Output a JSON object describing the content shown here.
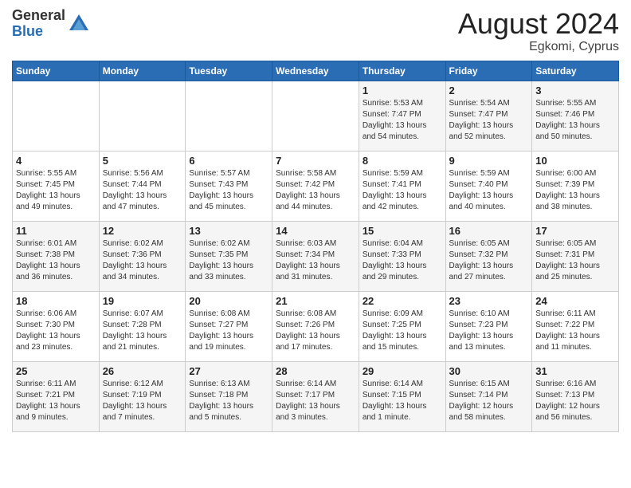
{
  "logo": {
    "general": "General",
    "blue": "Blue"
  },
  "title": {
    "month_year": "August 2024",
    "location": "Egkomi, Cyprus"
  },
  "calendar": {
    "headers": [
      "Sunday",
      "Monday",
      "Tuesday",
      "Wednesday",
      "Thursday",
      "Friday",
      "Saturday"
    ],
    "weeks": [
      [
        {
          "day": "",
          "details": ""
        },
        {
          "day": "",
          "details": ""
        },
        {
          "day": "",
          "details": ""
        },
        {
          "day": "",
          "details": ""
        },
        {
          "day": "1",
          "details": "Sunrise: 5:53 AM\nSunset: 7:47 PM\nDaylight: 13 hours\nand 54 minutes."
        },
        {
          "day": "2",
          "details": "Sunrise: 5:54 AM\nSunset: 7:47 PM\nDaylight: 13 hours\nand 52 minutes."
        },
        {
          "day": "3",
          "details": "Sunrise: 5:55 AM\nSunset: 7:46 PM\nDaylight: 13 hours\nand 50 minutes."
        }
      ],
      [
        {
          "day": "4",
          "details": "Sunrise: 5:55 AM\nSunset: 7:45 PM\nDaylight: 13 hours\nand 49 minutes."
        },
        {
          "day": "5",
          "details": "Sunrise: 5:56 AM\nSunset: 7:44 PM\nDaylight: 13 hours\nand 47 minutes."
        },
        {
          "day": "6",
          "details": "Sunrise: 5:57 AM\nSunset: 7:43 PM\nDaylight: 13 hours\nand 45 minutes."
        },
        {
          "day": "7",
          "details": "Sunrise: 5:58 AM\nSunset: 7:42 PM\nDaylight: 13 hours\nand 44 minutes."
        },
        {
          "day": "8",
          "details": "Sunrise: 5:59 AM\nSunset: 7:41 PM\nDaylight: 13 hours\nand 42 minutes."
        },
        {
          "day": "9",
          "details": "Sunrise: 5:59 AM\nSunset: 7:40 PM\nDaylight: 13 hours\nand 40 minutes."
        },
        {
          "day": "10",
          "details": "Sunrise: 6:00 AM\nSunset: 7:39 PM\nDaylight: 13 hours\nand 38 minutes."
        }
      ],
      [
        {
          "day": "11",
          "details": "Sunrise: 6:01 AM\nSunset: 7:38 PM\nDaylight: 13 hours\nand 36 minutes."
        },
        {
          "day": "12",
          "details": "Sunrise: 6:02 AM\nSunset: 7:36 PM\nDaylight: 13 hours\nand 34 minutes."
        },
        {
          "day": "13",
          "details": "Sunrise: 6:02 AM\nSunset: 7:35 PM\nDaylight: 13 hours\nand 33 minutes."
        },
        {
          "day": "14",
          "details": "Sunrise: 6:03 AM\nSunset: 7:34 PM\nDaylight: 13 hours\nand 31 minutes."
        },
        {
          "day": "15",
          "details": "Sunrise: 6:04 AM\nSunset: 7:33 PM\nDaylight: 13 hours\nand 29 minutes."
        },
        {
          "day": "16",
          "details": "Sunrise: 6:05 AM\nSunset: 7:32 PM\nDaylight: 13 hours\nand 27 minutes."
        },
        {
          "day": "17",
          "details": "Sunrise: 6:05 AM\nSunset: 7:31 PM\nDaylight: 13 hours\nand 25 minutes."
        }
      ],
      [
        {
          "day": "18",
          "details": "Sunrise: 6:06 AM\nSunset: 7:30 PM\nDaylight: 13 hours\nand 23 minutes."
        },
        {
          "day": "19",
          "details": "Sunrise: 6:07 AM\nSunset: 7:28 PM\nDaylight: 13 hours\nand 21 minutes."
        },
        {
          "day": "20",
          "details": "Sunrise: 6:08 AM\nSunset: 7:27 PM\nDaylight: 13 hours\nand 19 minutes."
        },
        {
          "day": "21",
          "details": "Sunrise: 6:08 AM\nSunset: 7:26 PM\nDaylight: 13 hours\nand 17 minutes."
        },
        {
          "day": "22",
          "details": "Sunrise: 6:09 AM\nSunset: 7:25 PM\nDaylight: 13 hours\nand 15 minutes."
        },
        {
          "day": "23",
          "details": "Sunrise: 6:10 AM\nSunset: 7:23 PM\nDaylight: 13 hours\nand 13 minutes."
        },
        {
          "day": "24",
          "details": "Sunrise: 6:11 AM\nSunset: 7:22 PM\nDaylight: 13 hours\nand 11 minutes."
        }
      ],
      [
        {
          "day": "25",
          "details": "Sunrise: 6:11 AM\nSunset: 7:21 PM\nDaylight: 13 hours\nand 9 minutes."
        },
        {
          "day": "26",
          "details": "Sunrise: 6:12 AM\nSunset: 7:19 PM\nDaylight: 13 hours\nand 7 minutes."
        },
        {
          "day": "27",
          "details": "Sunrise: 6:13 AM\nSunset: 7:18 PM\nDaylight: 13 hours\nand 5 minutes."
        },
        {
          "day": "28",
          "details": "Sunrise: 6:14 AM\nSunset: 7:17 PM\nDaylight: 13 hours\nand 3 minutes."
        },
        {
          "day": "29",
          "details": "Sunrise: 6:14 AM\nSunset: 7:15 PM\nDaylight: 13 hours\nand 1 minute."
        },
        {
          "day": "30",
          "details": "Sunrise: 6:15 AM\nSunset: 7:14 PM\nDaylight: 12 hours\nand 58 minutes."
        },
        {
          "day": "31",
          "details": "Sunrise: 6:16 AM\nSunset: 7:13 PM\nDaylight: 12 hours\nand 56 minutes."
        }
      ]
    ]
  }
}
